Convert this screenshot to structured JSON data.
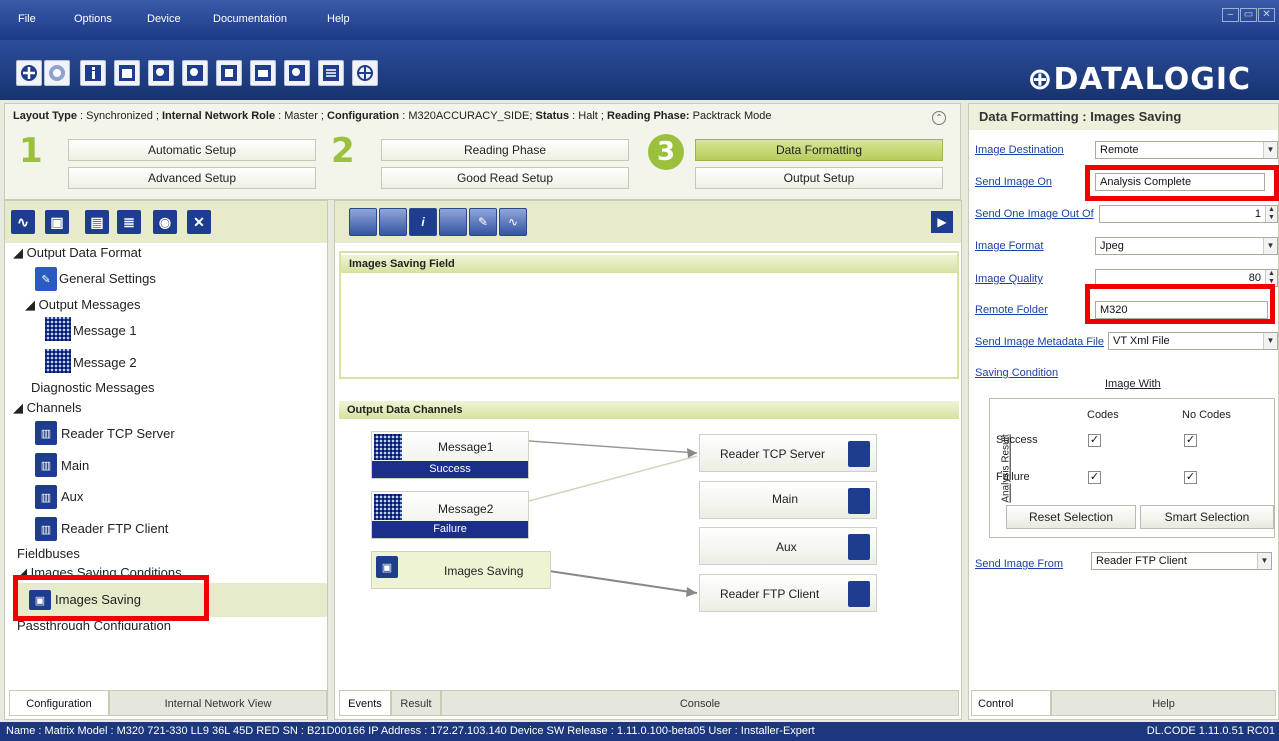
{
  "menu": [
    "File",
    "Options",
    "Device",
    "Documentation",
    "Help"
  ],
  "brand": "DATALOGIC",
  "status_line": {
    "layout_label": "Layout Type",
    "layout_value": "Synchronized",
    "role_label": "Internal Network Role",
    "role_value": "Master",
    "config_label": "Configuration",
    "config_value": "M320ACCURACY_SIDE",
    "status_label": "Status",
    "status_value": "Halt",
    "phase_label": "Reading Phase:",
    "phase_value": "Packtrack Mode"
  },
  "steps": {
    "n1": "1",
    "n2": "2",
    "n3": "3",
    "automatic": "Automatic Setup",
    "advanced": "Advanced Setup",
    "reading": "Reading Phase",
    "goodread": "Good Read Setup",
    "formatting": "Data Formatting",
    "output": "Output Setup"
  },
  "tree": {
    "output_data_format": "Output Data Format",
    "general_settings": "General Settings",
    "output_messages": "Output Messages",
    "message1": "Message 1",
    "message2": "Message 2",
    "diagnostic": "Diagnostic Messages",
    "channels": "Channels",
    "tcp": "Reader TCP Server",
    "main": "Main",
    "aux": "Aux",
    "ftp": "Reader FTP Client",
    "fieldbuses": "Fieldbuses",
    "isc": "Images Saving Conditions",
    "images_saving": "Images Saving",
    "passthrough": "Passthrough Configuration"
  },
  "left_tabs": [
    "Configuration",
    "Internal Network View"
  ],
  "center": {
    "isf_title": "Images Saving Field",
    "odc_title": "Output Data Channels",
    "msg1": "Message1",
    "msg1_status": "Success",
    "msg2": "Message2",
    "msg2_status": "Failure",
    "images_saving": "Images Saving",
    "ch_tcp": "Reader TCP Server",
    "ch_main": "Main",
    "ch_aux": "Aux",
    "ch_ftp": "Reader FTP Client",
    "tab_events": "Events",
    "tab_result": "Result",
    "tab_console": "Console"
  },
  "right": {
    "title": "Data Formatting :  Images Saving",
    "image_destination_label": "Image Destination",
    "image_destination_value": "Remote",
    "send_image_on_label": "Send Image On",
    "send_image_on_value": "Analysis Complete",
    "send_one_label": "Send One Image Out Of",
    "send_one_value": "1",
    "image_format_label": "Image Format",
    "image_format_value": "Jpeg",
    "image_quality_label": "Image Quality",
    "image_quality_value": "80",
    "remote_folder_label": "Remote Folder",
    "remote_folder_value": "M320",
    "metadata_label": "Send Image Metadata File",
    "metadata_value": "VT Xml File",
    "saving_condition_label": "Saving Condition",
    "image_with": "Image With",
    "codes": "Codes",
    "no_codes": "No Codes",
    "analysis_result": "Analysis Result",
    "success": "Success",
    "failure": "Failure",
    "reset": "Reset Selection",
    "smart": "Smart Selection",
    "send_from_label": "Send Image From",
    "send_from_value": "Reader FTP Client",
    "tab_control": "Control",
    "tab_help": "Help"
  },
  "statusbar": {
    "left": "Name : Matrix  Model : M320 721-330 LL9 36L 45D RED   SN : B21D00166   IP Address :  172.27.103.140   Device SW Release : 1.11.0.100-beta05   User : Installer-Expert",
    "right": "DL.CODE 1.11.0.51 RC01"
  },
  "colors": {
    "accent": "#9ac03d",
    "navy": "#1c3780",
    "highlight": "#ee0000"
  }
}
